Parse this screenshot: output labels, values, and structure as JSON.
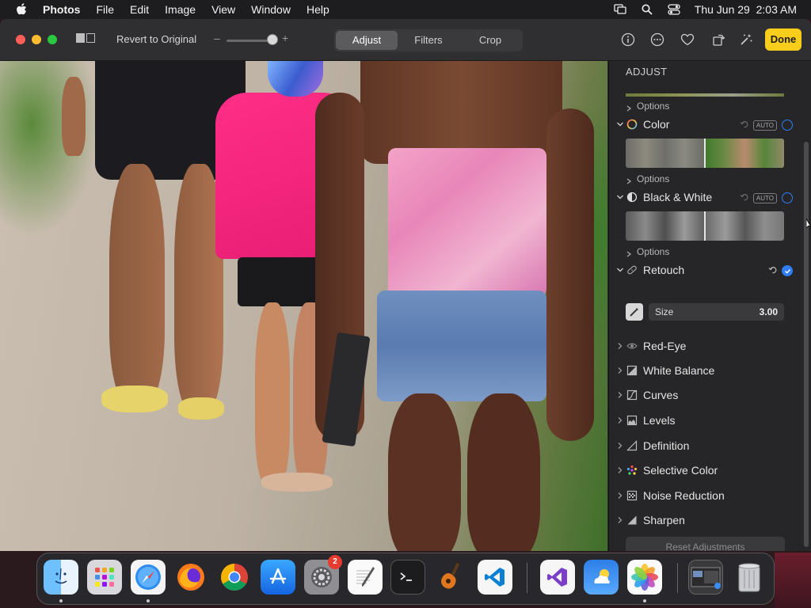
{
  "menubar": {
    "app_name": "Photos",
    "menus": [
      "File",
      "Edit",
      "Image",
      "View",
      "Window",
      "Help"
    ],
    "clock": "Thu Jun 29  2:03 AM",
    "status_icons": [
      "screen-mirroring-icon",
      "spotlight-icon",
      "control-center-icon"
    ]
  },
  "toolbar": {
    "revert_label": "Revert to Original",
    "zoom_minus": "–",
    "zoom_plus": "+",
    "zoom_level": 0.8,
    "tabs": [
      {
        "label": "Adjust",
        "active": true
      },
      {
        "label": "Filters",
        "active": false
      },
      {
        "label": "Crop",
        "active": false
      }
    ],
    "right_icons": [
      "info-icon",
      "more-icon",
      "favorite-icon",
      "rotate-icon",
      "auto-enhance-icon"
    ],
    "done_label": "Done"
  },
  "sidebar": {
    "header": "ADJUST",
    "options_label": "Options",
    "auto_label": "AUTO",
    "color": {
      "label": "Color"
    },
    "bw": {
      "label": "Black & White"
    },
    "retouch": {
      "label": "Retouch",
      "size_label": "Size",
      "size_value": "3.00"
    },
    "sections": [
      {
        "label": "Red-Eye",
        "icon": "red-eye-icon"
      },
      {
        "label": "White Balance",
        "icon": "white-balance-icon"
      },
      {
        "label": "Curves",
        "icon": "curves-icon"
      },
      {
        "label": "Levels",
        "icon": "levels-icon"
      },
      {
        "label": "Definition",
        "icon": "definition-icon"
      },
      {
        "label": "Selective Color",
        "icon": "selective-color-icon"
      },
      {
        "label": "Noise Reduction",
        "icon": "noise-reduction-icon"
      },
      {
        "label": "Sharpen",
        "icon": "sharpen-icon"
      }
    ],
    "reset_label": "Reset Adjustments"
  },
  "dock": {
    "apps": [
      "Finder",
      "Launchpad",
      "Safari",
      "Firefox",
      "Google Chrome",
      "App Store",
      "System Settings",
      "TextEdit",
      "Terminal",
      "GarageBand",
      "Visual Studio Code",
      "Visual Studio",
      "Weather",
      "Photos",
      "Preview",
      "Trash"
    ],
    "settings_badge": "2"
  },
  "colors": {
    "accent_blue": "#2f7ef5",
    "done_yellow": "#f9cd1b",
    "sidebar_bg": "#262628"
  }
}
